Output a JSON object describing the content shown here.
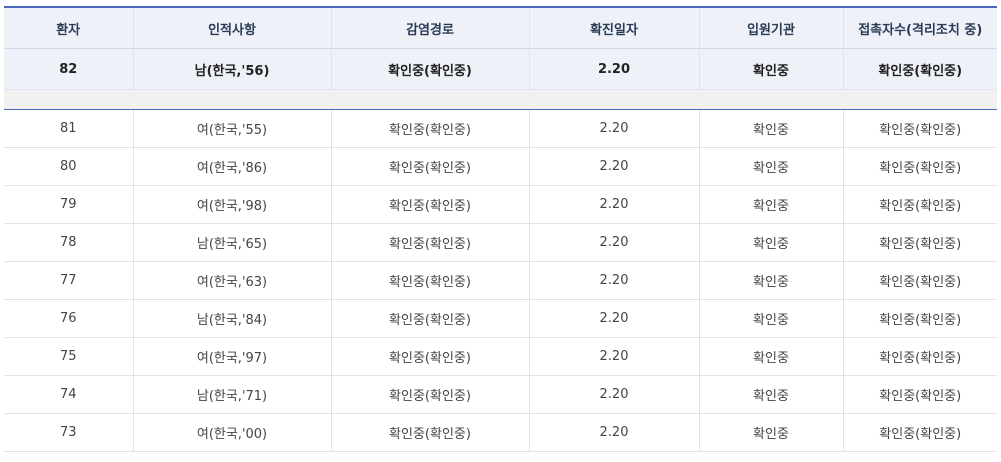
{
  "table": {
    "columns": [
      "환자",
      "인적사항",
      "감염경로",
      "확진일자",
      "입원기관",
      "접촉자수(격리조치 중)"
    ],
    "highlight_row": [
      "82",
      "남(한국,'56)",
      "확인중(확인중)",
      "2.20",
      "확인중",
      "확인중(확인중)"
    ],
    "rows": [
      [
        "81",
        "여(한국,'55)",
        "확인중(확인중)",
        "2.20",
        "확인중",
        "확인중(확인중)"
      ],
      [
        "80",
        "여(한국,'86)",
        "확인중(확인중)",
        "2.20",
        "확인중",
        "확인중(확인중)"
      ],
      [
        "79",
        "여(한국,'98)",
        "확인중(확인중)",
        "2.20",
        "확인중",
        "확인중(확인중)"
      ],
      [
        "78",
        "남(한국,'65)",
        "확인중(확인중)",
        "2.20",
        "확인중",
        "확인중(확인중)"
      ],
      [
        "77",
        "여(한국,'63)",
        "확인중(확인중)",
        "2.20",
        "확인중",
        "확인중(확인중)"
      ],
      [
        "76",
        "남(한국,'84)",
        "확인중(확인중)",
        "2.20",
        "확인중",
        "확인중(확인중)"
      ],
      [
        "75",
        "여(한국,'97)",
        "확인중(확인중)",
        "2.20",
        "확인중",
        "확인중(확인중)"
      ],
      [
        "74",
        "남(한국,'71)",
        "확인중(확인중)",
        "2.20",
        "확인중",
        "확인중(확인중)"
      ],
      [
        "73",
        "여(한국,'00)",
        "확인중(확인중)",
        "2.20",
        "확인중",
        "확인중(확인중)"
      ]
    ]
  },
  "colors": {
    "header_border": "#4a67b8",
    "header_bg": "#eef2f8",
    "spacer_bg": "#f1f1f1"
  }
}
